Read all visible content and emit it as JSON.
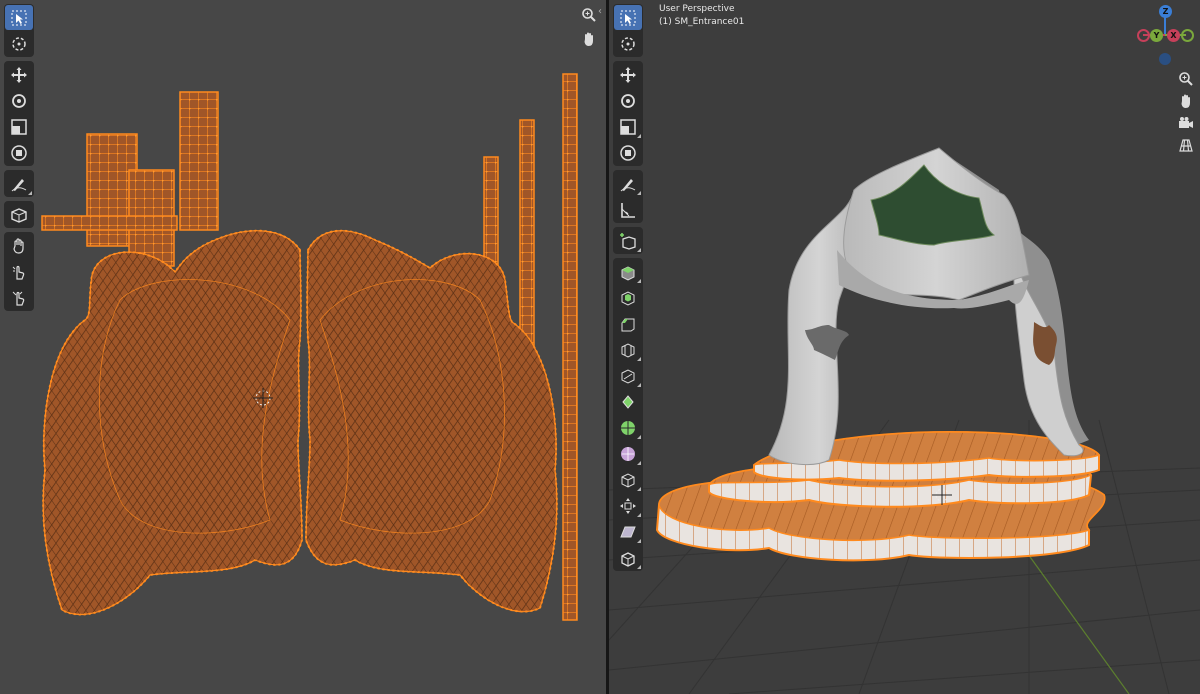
{
  "uv_editor": {
    "toolbar": [
      {
        "name": "select-box",
        "icon": "cursor-select-icon",
        "active": true
      },
      {
        "name": "cursor",
        "icon": "3d-cursor-icon"
      },
      {
        "name": "move",
        "icon": "move-icon"
      },
      {
        "name": "rotate",
        "icon": "rotate-icon"
      },
      {
        "name": "scale",
        "icon": "scale-icon"
      },
      {
        "name": "transform",
        "icon": "transform-icon"
      },
      {
        "name": "annotate",
        "icon": "annotate-icon"
      },
      {
        "name": "rip-region",
        "icon": "rip-icon"
      },
      {
        "name": "grab",
        "icon": "grab-icon"
      },
      {
        "name": "relax",
        "icon": "relax-icon"
      },
      {
        "name": "pinch",
        "icon": "pinch-icon"
      }
    ],
    "nav": [
      "zoom-icon",
      "pan-hand-icon"
    ],
    "colors": {
      "background": "#474747",
      "mesh_fill": "#a85a2a",
      "mesh_edge": "#ff8a1e",
      "vertex": "#ff8a1e"
    }
  },
  "viewport": {
    "title": "User Perspective",
    "object": "(1) SM_Entrance01",
    "gizmo": {
      "z": "Z",
      "y": "Y",
      "x": "X"
    },
    "nav": [
      "zoom-icon",
      "pan-hand-icon",
      "camera-icon",
      "ortho-grid-icon"
    ],
    "toolbar": [
      {
        "name": "select-box",
        "icon": "cursor-select-icon",
        "active": true
      },
      {
        "name": "cursor",
        "icon": "3d-cursor-icon"
      },
      {
        "name": "move",
        "icon": "move-icon"
      },
      {
        "name": "rotate",
        "icon": "rotate-icon"
      },
      {
        "name": "scale",
        "icon": "scale-icon"
      },
      {
        "name": "transform",
        "icon": "transform-icon"
      },
      {
        "name": "annotate",
        "icon": "annotate-icon"
      },
      {
        "name": "measure",
        "icon": "measure-icon"
      },
      {
        "name": "add-cube",
        "icon": "add-cube-icon"
      },
      {
        "name": "extrude",
        "icon": "extrude-icon"
      },
      {
        "name": "inset",
        "icon": "inset-icon"
      },
      {
        "name": "bevel",
        "icon": "bevel-icon"
      },
      {
        "name": "loop-cut",
        "icon": "loop-cut-icon"
      },
      {
        "name": "knife",
        "icon": "knife-icon"
      },
      {
        "name": "poly-build",
        "icon": "poly-build-icon"
      },
      {
        "name": "spin",
        "icon": "spin-icon"
      },
      {
        "name": "smooth",
        "icon": "smooth-icon"
      },
      {
        "name": "edge-slide",
        "icon": "edge-slide-icon"
      },
      {
        "name": "shrink-fatten",
        "icon": "shrink-fatten-icon"
      },
      {
        "name": "shear",
        "icon": "shear-icon"
      },
      {
        "name": "rip",
        "icon": "rip-icon"
      }
    ],
    "colors": {
      "background": "#3d3d3d",
      "arch": "#c9c9c9",
      "leaf": "#2d4a30",
      "selected_outline": "#ff8a1e",
      "x_axis": "#c6405a",
      "y_axis": "#7aa83c",
      "z_axis": "#3a7ed6"
    }
  }
}
